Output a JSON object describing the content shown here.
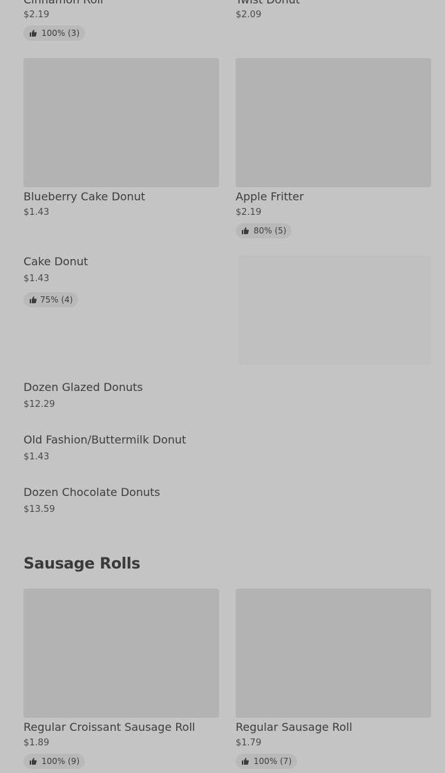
{
  "top_items": [
    {
      "name": "Cinnamon Roll",
      "price": "$2.19",
      "rating": "100% (3)"
    },
    {
      "name": "Twist Donut",
      "price": "$2.09"
    }
  ],
  "items": {
    "blueberry": {
      "name": "Blueberry Cake Donut",
      "price": "$1.43"
    },
    "apple_fritter": {
      "name": "Apple Fritter",
      "price": "$2.19",
      "rating": "80% (5)"
    },
    "cake_donut": {
      "name": "Cake Donut",
      "price": "$1.43",
      "rating": "75% (4)"
    },
    "dozen_glazed": {
      "name": "Dozen Glazed Donuts",
      "price": "$12.29"
    },
    "old_fashion": {
      "name": "Old Fashion/Buttermilk Donut",
      "price": "$1.43"
    },
    "dozen_chocolate": {
      "name": "Dozen Chocolate Donuts",
      "price": "$13.59"
    }
  },
  "sausage_section": {
    "title": "Sausage Rolls",
    "items": [
      {
        "name": "Regular Croissant Sausage Roll",
        "price": "$1.89",
        "rating": "100% (9)"
      },
      {
        "name": "Regular Sausage Roll",
        "price": "$1.79",
        "rating": "100% (7)"
      }
    ]
  },
  "icons": {
    "rating": "thumbs-up-icon"
  },
  "colors": {
    "background": "#c4c4c4",
    "image_placeholder": "#b3b3b3",
    "badge": "#b9b9b9",
    "text": "#3d3d3d"
  }
}
